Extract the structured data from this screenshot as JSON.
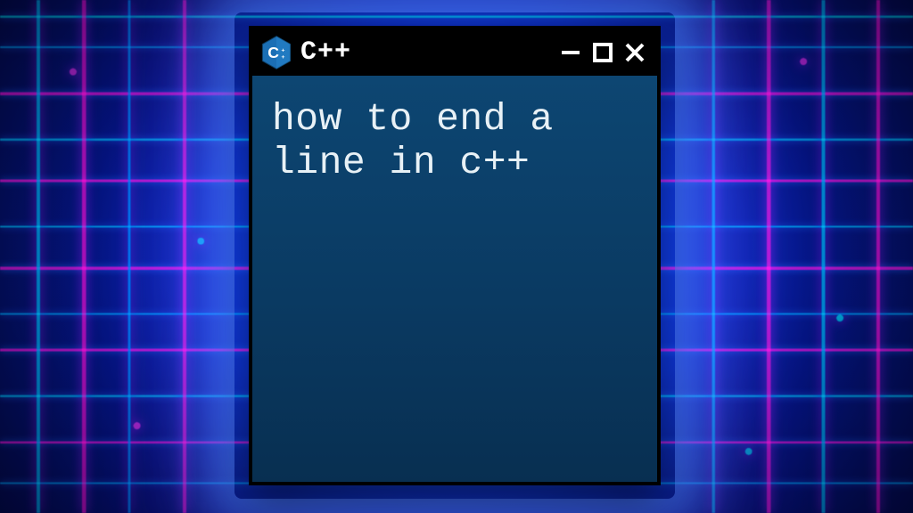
{
  "window": {
    "title": "C++",
    "content_text": "how to end a\nline in c++",
    "icons": {
      "minimize": "minimize-icon",
      "maximize": "maximize-icon",
      "close": "close-icon",
      "logo": "cpp-logo-icon"
    }
  },
  "colors": {
    "titlebar": "#000000",
    "window_body": "#0b3e66",
    "logo_blue": "#1b6fb5",
    "text": "#e8f1f6"
  }
}
